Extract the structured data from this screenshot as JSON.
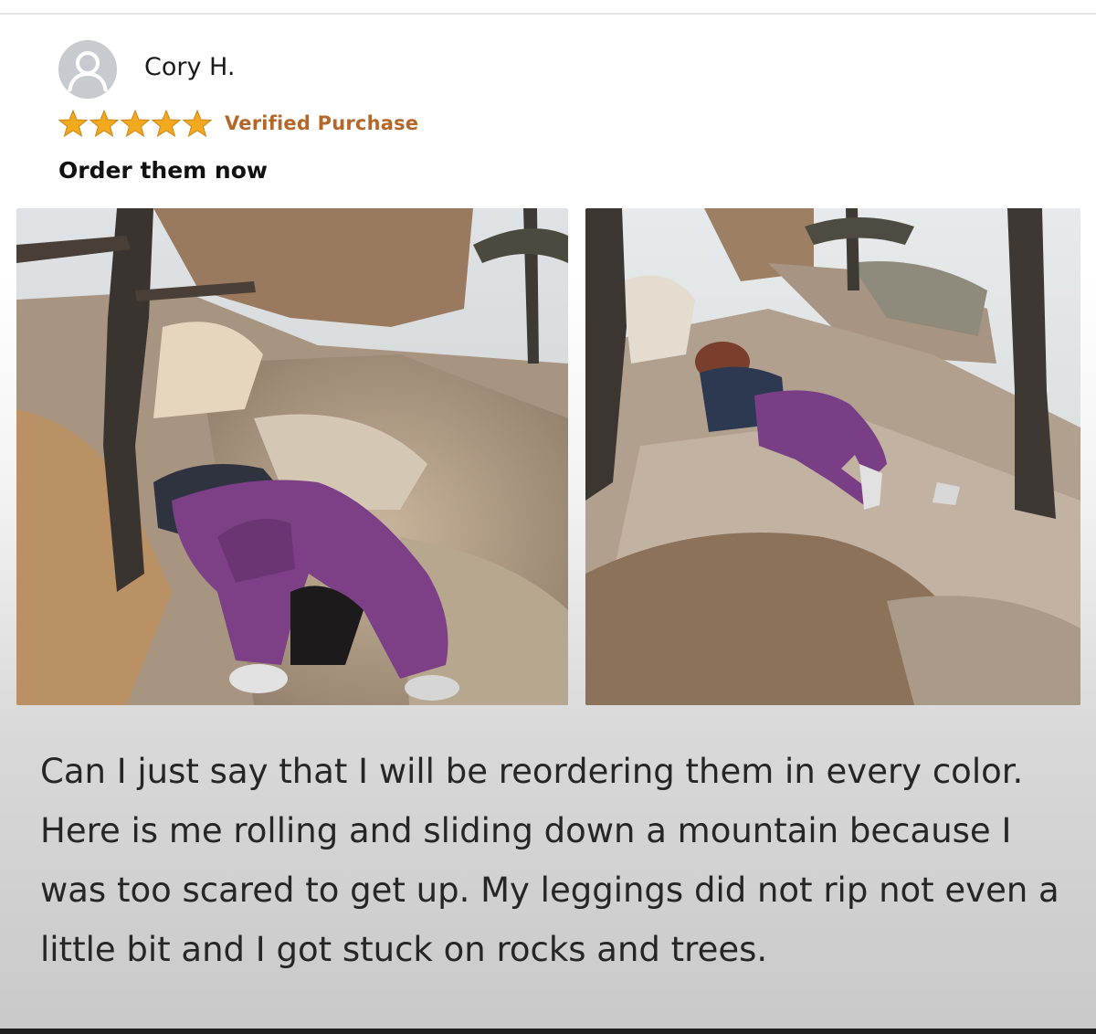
{
  "review": {
    "reviewer_name": "Cory H.",
    "rating": 5,
    "rating_max": 5,
    "verified_label": "Verified Purchase",
    "title": "Order them now",
    "body": "Can I just say that I will be reordering them in every color. Here is me rolling and sliding down a mountain because I was too scared to get up. My leggings did not rip not even a little bit and I got stuck on rocks and trees."
  },
  "icons": {
    "avatar": "default-user-avatar-icon",
    "star": "star-icon"
  },
  "colors": {
    "star": "#f2a91e",
    "verified": "#b5672a",
    "leggings": "#7d3f86"
  }
}
